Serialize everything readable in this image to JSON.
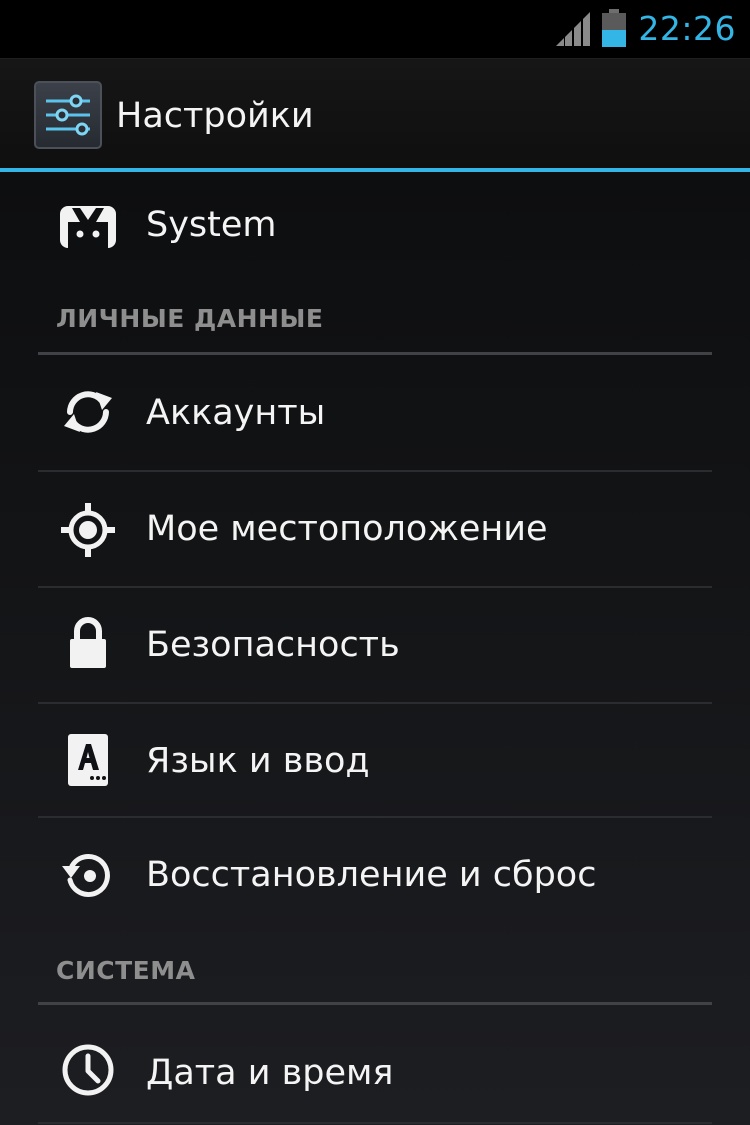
{
  "status_bar": {
    "time": "22:26",
    "accent_color": "#33b5e5",
    "signal_icon": "signal-bars-icon",
    "battery_icon": "battery-icon"
  },
  "action_bar": {
    "title": "Настройки",
    "icon": "settings-sliders-icon"
  },
  "top_items": [
    {
      "label": "System",
      "icon": "android-system-icon"
    }
  ],
  "sections": [
    {
      "header": "ЛИЧНЫЕ ДАННЫЕ",
      "items": [
        {
          "label": "Аккаунты",
          "icon": "sync-icon"
        },
        {
          "label": "Мое местоположение",
          "icon": "location-target-icon"
        },
        {
          "label": "Безопасность",
          "icon": "lock-icon"
        },
        {
          "label": "Язык и ввод",
          "icon": "keyboard-language-icon"
        },
        {
          "label": "Восстановление и сброс",
          "icon": "restore-icon"
        }
      ]
    },
    {
      "header": "СИСТЕМА",
      "items": [
        {
          "label": "Дата и время",
          "icon": "clock-icon"
        }
      ]
    }
  ]
}
